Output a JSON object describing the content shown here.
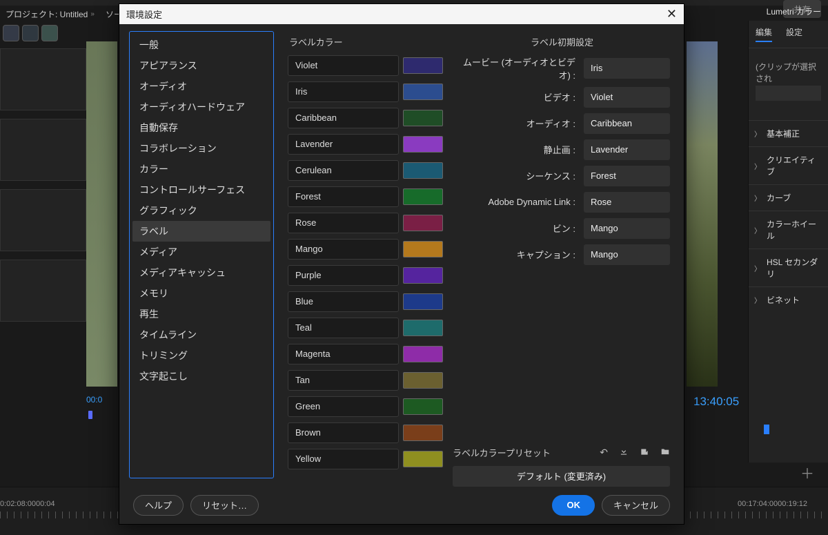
{
  "bg": {
    "share": "共有",
    "project_tab": "プロジェクト: Untitled",
    "source_tab": "ソース : (",
    "tc_left": "00:0",
    "tc_right": "13:40:05",
    "right_panel_title": "Lumetri カラー",
    "right_tabs": [
      "編集",
      "設定"
    ],
    "right_clip_note": "(クリップが選択され",
    "lumetri_sections": [
      "基本補正",
      "クリエイティブ",
      "カーブ",
      "カラーホイール",
      "HSL セカンダリ",
      "ビネット"
    ],
    "timeline_labels": [
      "0:02:08:00",
      "00:04",
      "00:17:04:00",
      "00:19:12"
    ]
  },
  "dialog": {
    "title": "環境設定",
    "categories": [
      "一般",
      "アピアランス",
      "オーディオ",
      "オーディオハードウェア",
      "自動保存",
      "コラボレーション",
      "カラー",
      "コントロールサーフェス",
      "グラフィック",
      "ラベル",
      "メディア",
      "メディアキャッシュ",
      "メモリ",
      "再生",
      "タイムライン",
      "トリミング",
      "文字起こし"
    ],
    "selected_category_index": 9,
    "label_colors_heading": "ラベルカラー",
    "label_defaults_heading": "ラベル初期設定",
    "labels": [
      {
        "name": "Violet",
        "hex": "#2e2a6e"
      },
      {
        "name": "Iris",
        "hex": "#2c4d8f"
      },
      {
        "name": "Caribbean",
        "hex": "#1f4d26"
      },
      {
        "name": "Lavender",
        "hex": "#8a3bc0"
      },
      {
        "name": "Cerulean",
        "hex": "#1b5a73"
      },
      {
        "name": "Forest",
        "hex": "#176b2a"
      },
      {
        "name": "Rose",
        "hex": "#7a1f45"
      },
      {
        "name": "Mango",
        "hex": "#b4791d"
      },
      {
        "name": "Purple",
        "hex": "#55249e"
      },
      {
        "name": "Blue",
        "hex": "#1d3a8a"
      },
      {
        "name": "Teal",
        "hex": "#1e6b6b"
      },
      {
        "name": "Magenta",
        "hex": "#8e2ca8"
      },
      {
        "name": "Tan",
        "hex": "#6b6030"
      },
      {
        "name": "Green",
        "hex": "#1d5a22"
      },
      {
        "name": "Brown",
        "hex": "#7a3e1a"
      },
      {
        "name": "Yellow",
        "hex": "#8f8f20"
      }
    ],
    "defaults": [
      {
        "label": "ムービー (オーディオとビデオ) :",
        "value": "Iris"
      },
      {
        "label": "ビデオ :",
        "value": "Violet"
      },
      {
        "label": "オーディオ :",
        "value": "Caribbean"
      },
      {
        "label": "静止画 :",
        "value": "Lavender"
      },
      {
        "label": "シーケンス :",
        "value": "Forest"
      },
      {
        "label": "Adobe Dynamic Link :",
        "value": "Rose"
      },
      {
        "label": "ビン :",
        "value": "Mango"
      },
      {
        "label": "キャプション :",
        "value": "Mango"
      }
    ],
    "preset_label": "ラベルカラープリセット",
    "preset_value": "デフォルト (変更済み)",
    "buttons": {
      "help": "ヘルプ",
      "reset": "リセット…",
      "ok": "OK",
      "cancel": "キャンセル"
    }
  }
}
